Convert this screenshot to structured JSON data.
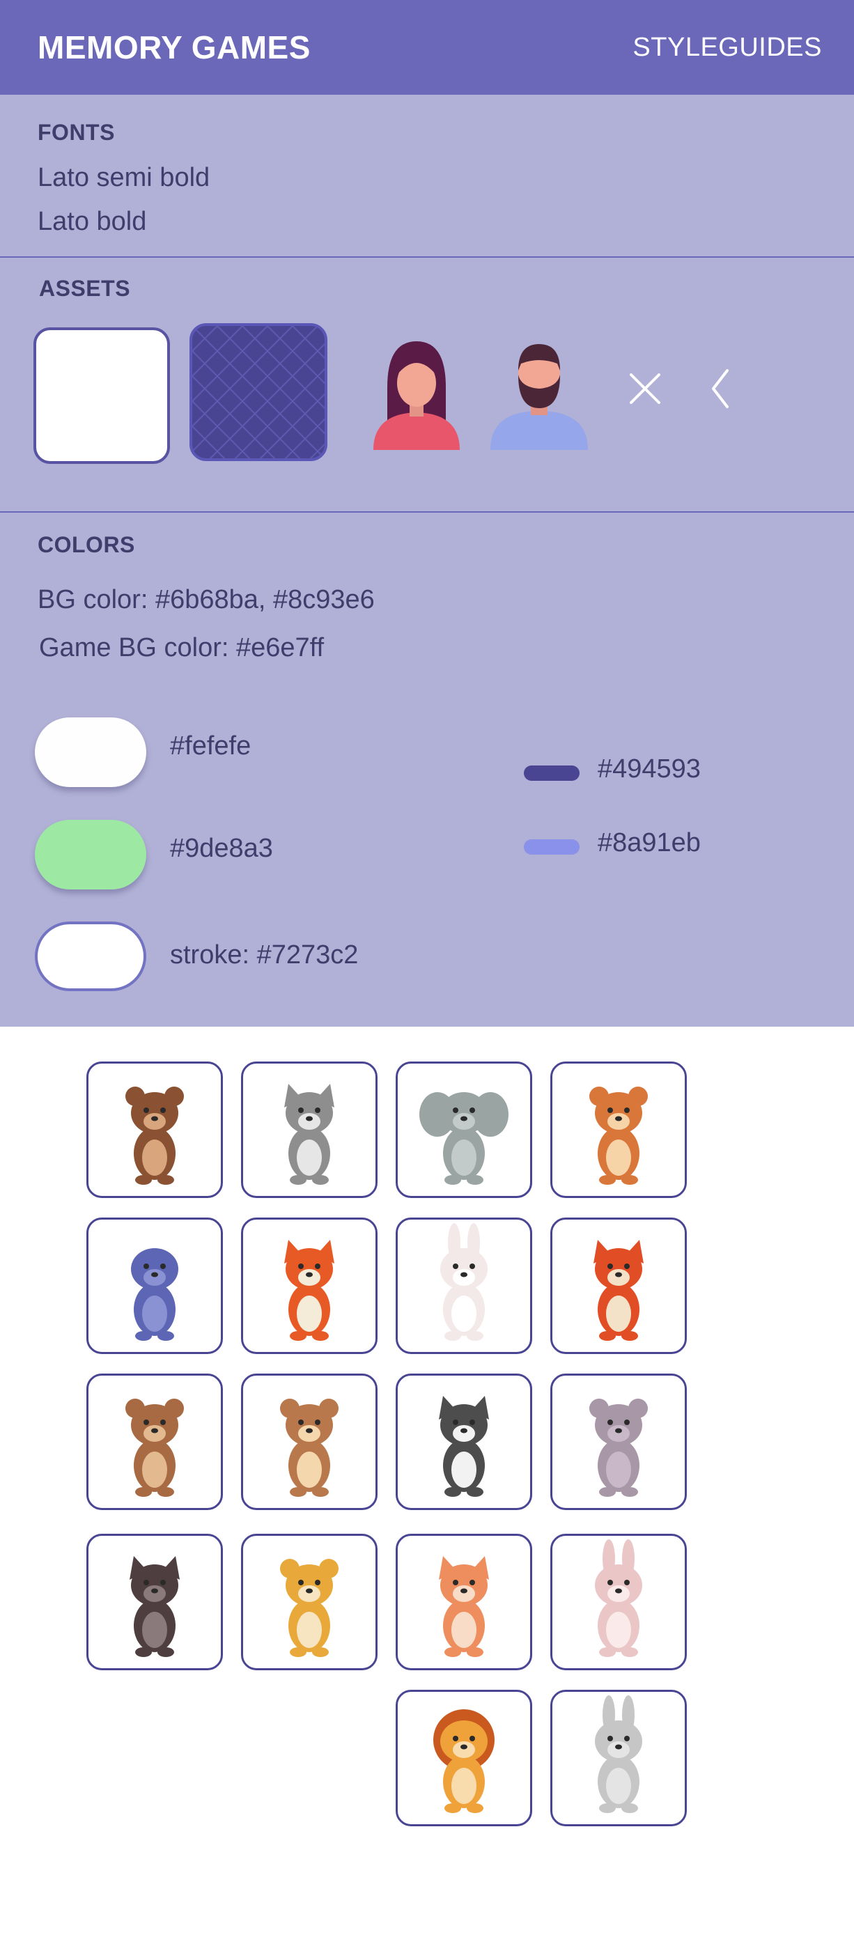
{
  "header": {
    "title": "MEMORY GAMES",
    "right_label": "STYLEGUIDES"
  },
  "fonts": {
    "title": "FONTS",
    "items": [
      "Lato semi bold",
      "Lato bold"
    ]
  },
  "assets": {
    "title": "ASSETS",
    "items": [
      "card-front",
      "card-back",
      "female-avatar",
      "male-avatar",
      "close-icon",
      "back-chevron-icon"
    ]
  },
  "colors": {
    "title": "COLORS",
    "bg_line": "BG color: #6b68ba, #8c93e6",
    "game_bg_line": "Game BG color: #e6e7ff",
    "swatches": [
      {
        "label": "#fefefe",
        "color": "#fefefe"
      },
      {
        "label": "#9de8a3",
        "color": "#9de8a3"
      },
      {
        "label": "stroke: #7273c2",
        "color": "#7273c2"
      }
    ],
    "bars": [
      {
        "label": "#494593",
        "color": "#494593"
      },
      {
        "label": "#8a91eb",
        "color": "#8a91eb"
      }
    ]
  },
  "animals": [
    {
      "name": "brown-bear",
      "body": "#8a5233",
      "belly": "#d9a57c",
      "ear": "ear-round"
    },
    {
      "name": "raccoon",
      "body": "#8e8e8e",
      "belly": "#e6e6e6",
      "ear": "ear-point"
    },
    {
      "name": "elephant",
      "body": "#9aa4a3",
      "belly": "#c3cbca",
      "ear": "ear-big"
    },
    {
      "name": "squirrel",
      "body": "#d9773b",
      "belly": "#f7d3a8",
      "ear": "ear-round"
    },
    {
      "name": "seal",
      "body": "#5d66b4",
      "belly": "#8a92d4",
      "ear": "none"
    },
    {
      "name": "fox",
      "body": "#e85a25",
      "belly": "#f4ecd9",
      "ear": "ear-point"
    },
    {
      "name": "white-rabbit",
      "body": "#f2e9e8",
      "belly": "#ffffff",
      "ear": "ear-long"
    },
    {
      "name": "red-fox",
      "body": "#e14d24",
      "belly": "#f3e2c7",
      "ear": "ear-point"
    },
    {
      "name": "beaver",
      "body": "#a86a43",
      "belly": "#e3b98f",
      "ear": "ear-round"
    },
    {
      "name": "chipmunk",
      "body": "#b9784c",
      "belly": "#f5d7ad",
      "ear": "ear-round"
    },
    {
      "name": "black-cat",
      "body": "#4d4d4d",
      "belly": "#f2f2f2",
      "ear": "ear-point"
    },
    {
      "name": "hippo",
      "body": "#a897a7",
      "belly": "#c9b8c7",
      "ear": "ear-round"
    },
    {
      "name": "dark-raccoon",
      "body": "#4f3e3f",
      "belly": "#8a7a7b",
      "ear": "ear-point"
    },
    {
      "name": "tiger",
      "body": "#e8a93a",
      "belly": "#f7e4c0",
      "ear": "ear-round"
    },
    {
      "name": "deer",
      "body": "#ee8d5d",
      "belly": "#f9dcc8",
      "ear": "ear-point"
    },
    {
      "name": "pink-rabbit",
      "body": "#ebc6c6",
      "belly": "#faeaea",
      "ear": "ear-long"
    },
    {
      "name": "lion",
      "body": "#f0a23a",
      "belly": "#f8dcae",
      "ear": "mane"
    },
    {
      "name": "grey-rabbit",
      "body": "#c6c6c6",
      "belly": "#e4e4e4",
      "ear": "ear-long"
    }
  ]
}
